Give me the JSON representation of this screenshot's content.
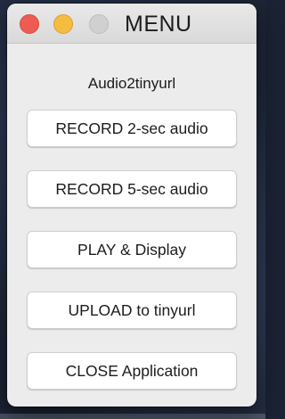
{
  "window": {
    "title": "MENU",
    "app_label": "Audio2tinyurl"
  },
  "buttons": [
    {
      "label": "RECORD 2-sec audio"
    },
    {
      "label": "RECORD 5-sec audio"
    },
    {
      "label": "PLAY & Display"
    },
    {
      "label": "UPLOAD to tinyurl"
    },
    {
      "label": "CLOSE Application"
    }
  ],
  "colors": {
    "close": "#ee5b53",
    "minimize": "#f5bd3f",
    "zoom": "#d0d0d0",
    "window_bg": "#ececec",
    "button_bg": "#ffffff"
  }
}
